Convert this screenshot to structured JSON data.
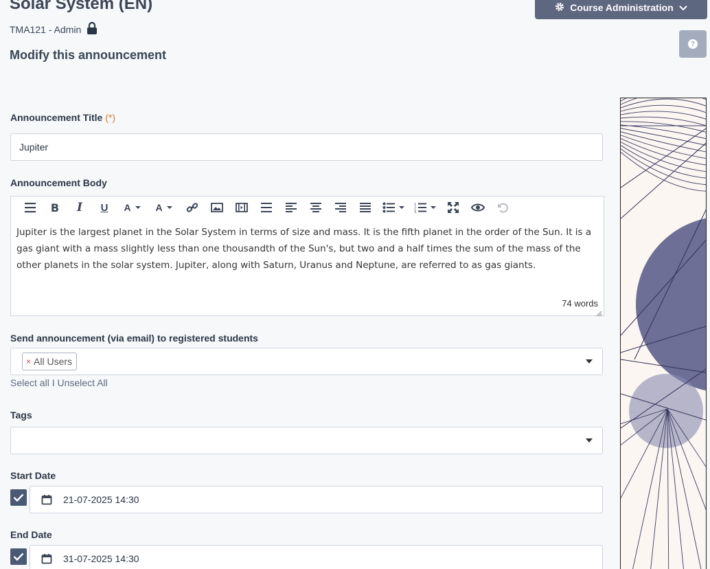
{
  "header": {
    "course_title": "Solar System (EN)",
    "course_code_role": "TMA121 - Admin",
    "page_heading": "Modify this announcement",
    "admin_button_label": "Course Administration"
  },
  "form": {
    "title_label": "Announcement Title",
    "required_marker": "(*)",
    "title_value": "Jupiter",
    "body_label": "Announcement Body",
    "body_text": "Jupiter is the largest planet in the Solar System in terms of size and mass. It is the fifth planet in the order of the Sun. It is a gas giant with a mass slightly less than one thousandth of the Sun's, but two and a half times the sum of the mass of the other planets in the solar system. Jupiter, along with Saturn, Uranus and Neptune, are referred to as gas giants.",
    "word_count": "74 words",
    "send_label": "Send announcement (via email) to registered students",
    "recipients_chip": "All Users",
    "select_all": "Select all",
    "separator": "I",
    "unselect_all": "Unselect All",
    "tags_label": "Tags",
    "start_date_label": "Start Date",
    "start_date_value": "21-07-2025 14:30",
    "end_date_label": "End Date",
    "end_date_value": "31-07-2025 14:30"
  },
  "toolbar_icons": [
    "format-icon",
    "bold-icon",
    "italic-icon",
    "underline-icon",
    "text-color-icon",
    "background-color-icon",
    "link-icon",
    "image-icon",
    "video-icon",
    "horizontal-rule-icon",
    "align-left-icon",
    "align-center-icon",
    "align-right-icon",
    "align-justify-icon",
    "bullet-list-icon",
    "numbered-list-icon",
    "fullscreen-icon",
    "preview-icon",
    "undo-icon"
  ],
  "colors": {
    "primary_button": "#5e6780",
    "help_button": "#a3abbd",
    "checkbox": "#4b5a74",
    "required": "#d57b2a",
    "art_purple": "#6e6f96"
  }
}
